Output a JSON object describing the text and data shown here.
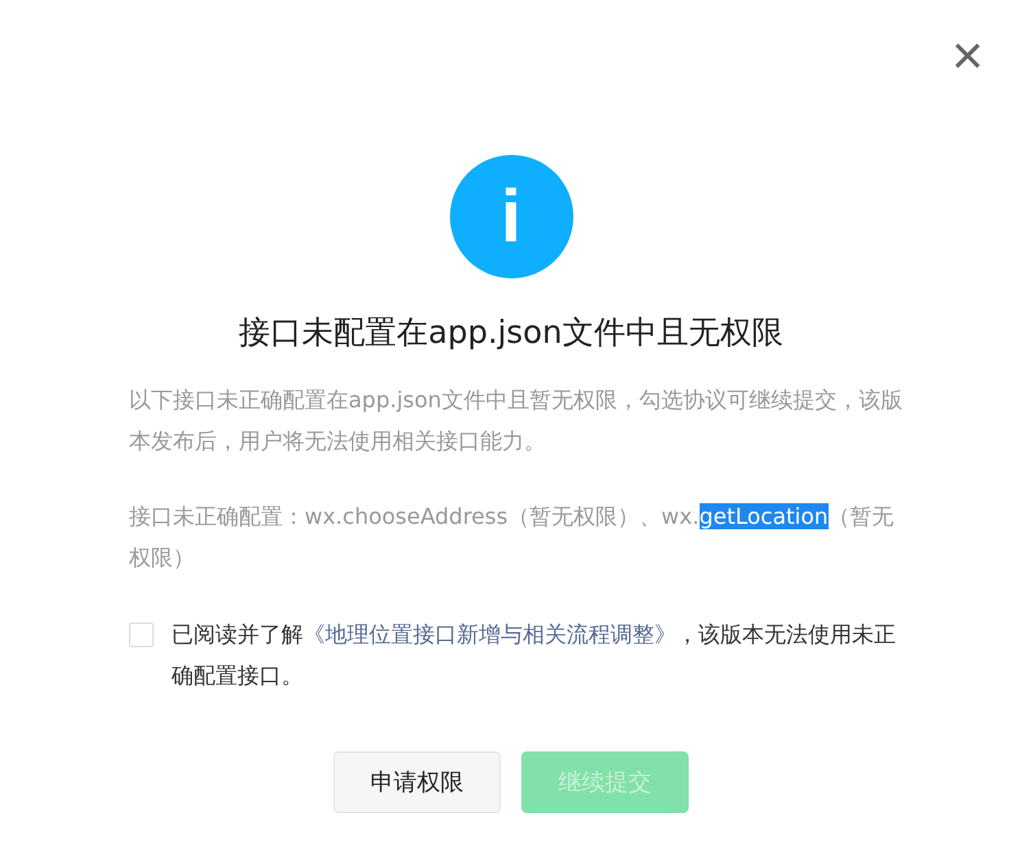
{
  "dialog": {
    "close": "×",
    "icon": "i",
    "title": "接口未配置在app.json文件中且无权限",
    "description": "以下接口未正确配置在app.json文件中且暂无权限，勾选协议可继续提交，该版本发布后，用户将无法使用相关接口能力。",
    "interfaces": [
      {
        "text": "接口未正确配置：wx.chooseAddress（暂无权限）、wx.",
        "highlighted": false
      },
      {
        "text": "getLocation",
        "highlighted": true
      },
      {
        "text": "（暂无权限）",
        "highlighted": false
      }
    ],
    "agreement": {
      "checked": false,
      "before": "已阅读并了解",
      "link": "《地理位置接口新增与相关流程调整》",
      "after": "，该版本无法使用未正确配置接口。"
    },
    "buttons": [
      {
        "label": "申请权限",
        "kind": "secondary",
        "disabled": false
      },
      {
        "label": "继续提交",
        "kind": "primary",
        "disabled": true
      }
    ]
  }
}
